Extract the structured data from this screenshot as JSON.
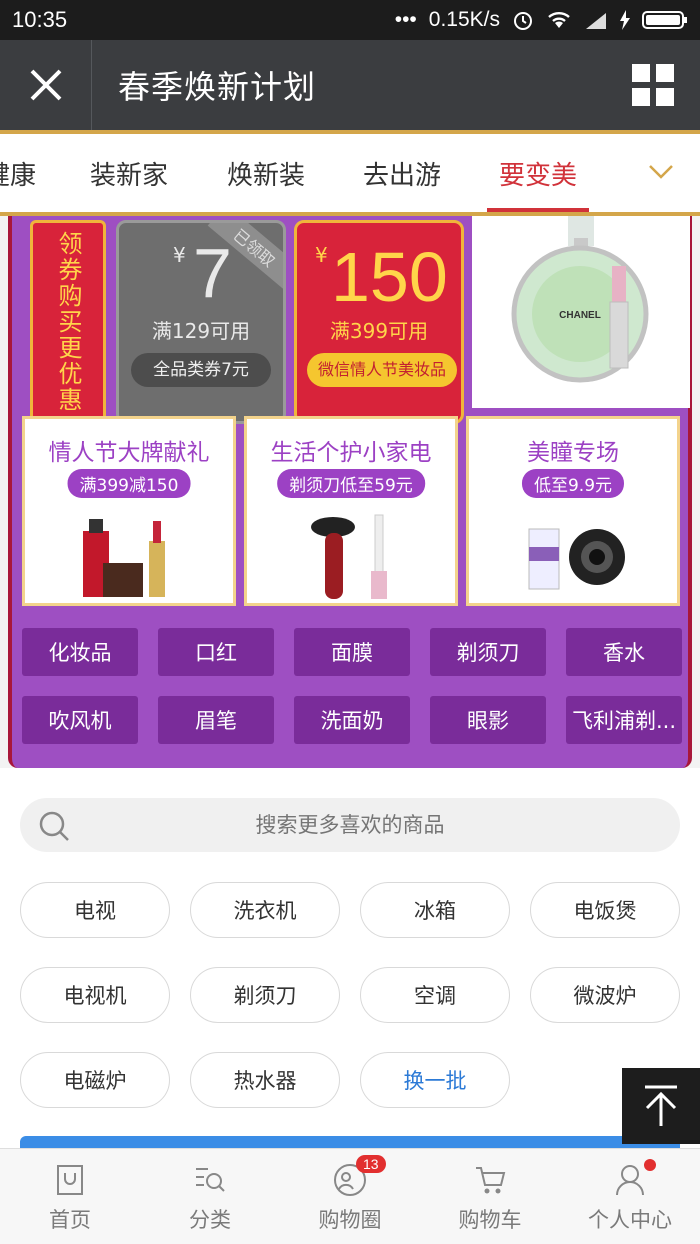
{
  "status_bar": {
    "time": "10:35",
    "dots": "•••",
    "speed": "0.15K/s"
  },
  "header": {
    "title": "春季焕新计划",
    "close_icon": "close-icon",
    "grid_icon": "grid-icon"
  },
  "tabs": [
    {
      "label": "健康"
    },
    {
      "label": "装新家"
    },
    {
      "label": "焕新装"
    },
    {
      "label": "去出游"
    },
    {
      "label": "要变美",
      "active": true
    }
  ],
  "promo": {
    "coupon_label": "领券购买更优惠",
    "coupon_gray": {
      "ribbon": "已领取",
      "currency": "¥",
      "amount": "7",
      "condition": "满129可用",
      "button": "全品类券7元"
    },
    "coupon_red": {
      "currency": "¥",
      "amount": "150",
      "condition": "满399可用",
      "button": "微信情人节美妆品"
    },
    "product_top": {
      "brand": "CHANEL"
    },
    "cards": [
      {
        "name": "情人节大牌献礼",
        "tag": "满399减150"
      },
      {
        "name": "生活个护小家电",
        "tag": "剃须刀低至59元"
      },
      {
        "name": "美瞳专场",
        "tag": "低至9.9元"
      }
    ],
    "keywords": [
      "化妆品",
      "口红",
      "面膜",
      "剃须刀",
      "香水",
      "吹风机",
      "眉笔",
      "洗面奶",
      "眼影",
      "飞利浦剃..."
    ]
  },
  "search": {
    "placeholder": "搜索更多喜欢的商品"
  },
  "hot_words": [
    "电视",
    "洗衣机",
    "冰箱",
    "电饭煲",
    "电视机",
    "剃须刀",
    "空调",
    "微波炉",
    "电磁炉",
    "热水器"
  ],
  "refresh_label": "换一批",
  "bottom_nav": [
    {
      "label": "首页",
      "icon": "bag-icon"
    },
    {
      "label": "分类",
      "icon": "search-list-icon"
    },
    {
      "label": "购物圈",
      "icon": "people-circle-icon",
      "badge": "13"
    },
    {
      "label": "购物车",
      "icon": "cart-icon"
    },
    {
      "label": "个人中心",
      "icon": "person-icon",
      "dot": true
    }
  ],
  "colors": {
    "accent": "#d1323a",
    "purple": "#9e4fc2",
    "gold": "#d4a64a",
    "link": "#2c7ad6"
  }
}
